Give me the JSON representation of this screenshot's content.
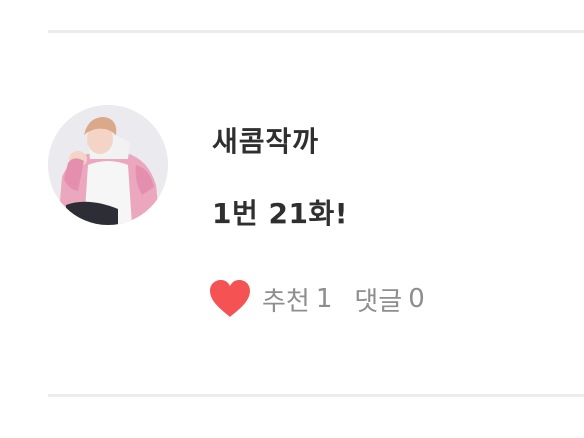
{
  "post": {
    "author": "새콤작까",
    "title": "1번 21화!",
    "recommend_label": "추천",
    "recommend_count": "1",
    "comment_label": "댓글",
    "comment_count": "0"
  },
  "icons": {
    "avatar": "profile-photo",
    "recommend": "heart-icon"
  },
  "colors": {
    "heart": "#f55353",
    "meta_text": "#8e8e8e",
    "primary_text": "#2f2f2f",
    "divider": "#ececec"
  }
}
